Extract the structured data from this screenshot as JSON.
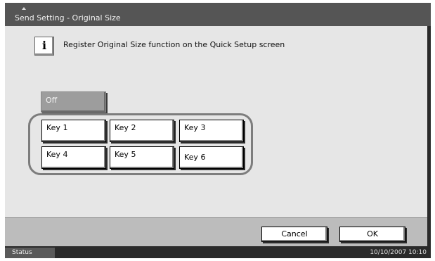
{
  "window": {
    "title": "Send Setting - Original Size"
  },
  "message": {
    "icon": "info-icon",
    "icon_glyph": "i",
    "text": "Register Original Size function on the Quick Setup screen"
  },
  "off_button": {
    "label": "Off"
  },
  "keys": [
    {
      "label": "Key 1"
    },
    {
      "label": "Key 2"
    },
    {
      "label": "Key 3"
    },
    {
      "label": "Key 4"
    },
    {
      "label": "Key 5"
    },
    {
      "label": "Key 6"
    }
  ],
  "footer": {
    "cancel_label": "Cancel",
    "ok_label": "OK"
  },
  "statusbar": {
    "status_label": "Status",
    "datetime": "10/10/2007   10:10"
  }
}
